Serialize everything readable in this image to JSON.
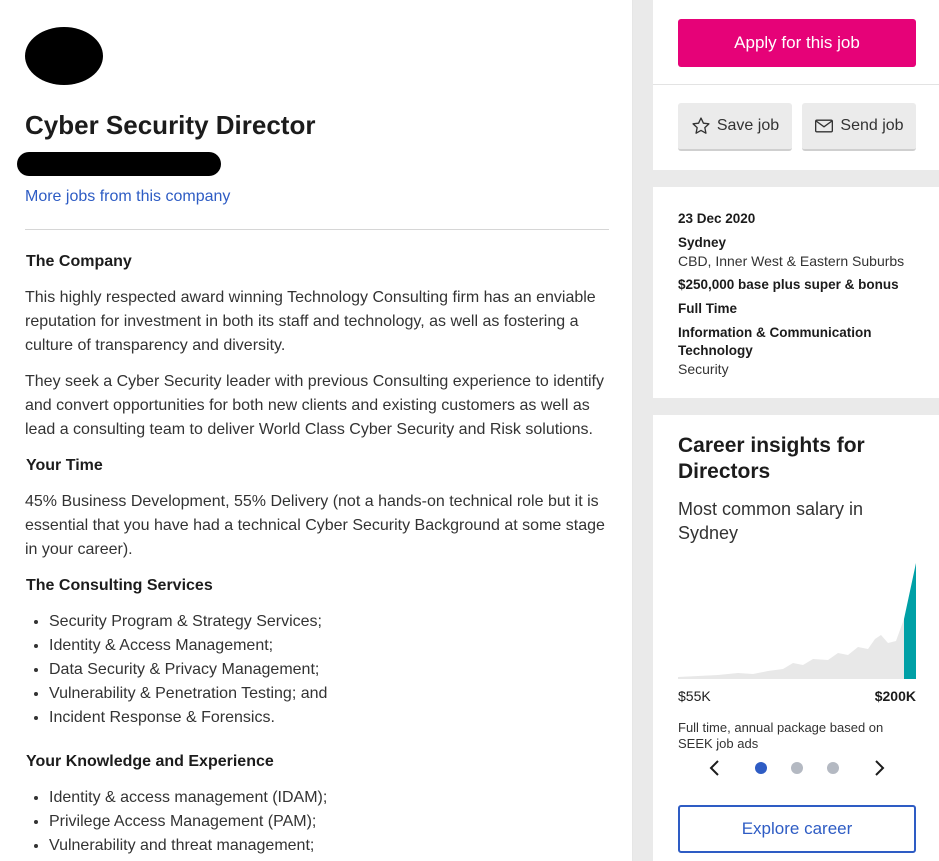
{
  "job": {
    "title": "Cyber Security Director",
    "more_jobs_link": "More jobs from this company"
  },
  "description": {
    "company_heading": "The Company",
    "company_p1": "This highly respected award winning Technology Consulting firm has an enviable reputation for investment in both its staff and technology, as well as fostering a culture of transparency and diversity.",
    "company_p2": "They seek a Cyber Security leader with previous Consulting experience to identify and convert opportunities for both new clients and existing customers as well as lead a consulting team to deliver World Class Cyber Security and Risk solutions.",
    "time_heading": "Your Time",
    "time_p": "45% Business Development, 55% Delivery (not a hands-on technical role but it is essential that you have had a technical Cyber Security Background at some stage in your career).",
    "services_heading": "The Consulting Services",
    "services": [
      "Security Program & Strategy Services;",
      "Identity & Access Management;",
      "Data Security & Privacy Management;",
      "Vulnerability & Penetration Testing; and",
      "Incident Response & Forensics."
    ],
    "knowledge_heading": "Your Knowledge and Experience",
    "knowledge": [
      "Identity & access management (IDAM);",
      "Privilege Access Management (PAM);",
      "Vulnerability and threat management;"
    ]
  },
  "actions": {
    "apply_label": "Apply for this job",
    "save_label": "Save job",
    "send_label": "Send job"
  },
  "meta": {
    "date": "23 Dec 2020",
    "location": "Sydney",
    "area": "CBD, Inner West & Eastern Suburbs",
    "salary": "$250,000 base plus super & bonus",
    "work_type": "Full Time",
    "classification": "Information & Communication Technology",
    "subclassification": "Security"
  },
  "insights": {
    "title": "Career insights for Directors",
    "subtitle": "Most common salary in Sydney",
    "min_label": "$55K",
    "max_label": "$200K",
    "note": "Full time, annual package based on SEEK job ads",
    "explore_label": "Explore career",
    "active_dot": 0,
    "dot_count": 3,
    "colors": {
      "distribution": "#e8e8e8",
      "highlight": "#00a0a6"
    }
  },
  "icons": {
    "save": "star-outline-icon",
    "send": "envelope-icon",
    "prev": "chevron-left-icon",
    "next": "chevron-right-icon"
  },
  "colors": {
    "apply_button": "#e60278",
    "link": "#2e5cc4",
    "background": "#eaeaea"
  }
}
